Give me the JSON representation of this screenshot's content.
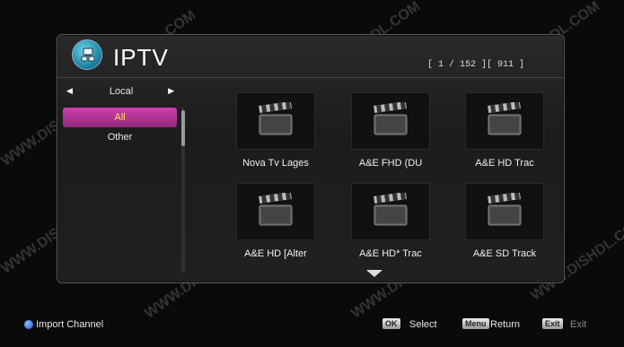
{
  "header": {
    "title": "IPTV",
    "counter": "[ 1 / 152 ][ 911 ]"
  },
  "categories": {
    "group_label": "Local",
    "items": [
      "All",
      "Other"
    ],
    "selected_index": 0
  },
  "channels": [
    {
      "label": "Nova Tv Lages",
      "icon": "clapperboard-icon"
    },
    {
      "label": "A&E FHD (DU",
      "icon": "clapperboard-icon"
    },
    {
      "label": "A&E HD  Trac",
      "icon": "clapperboard-icon"
    },
    {
      "label": "A&E HD [Alter",
      "icon": "clapperboard-icon"
    },
    {
      "label": "A&E HD*  Trac",
      "icon": "clapperboard-icon"
    },
    {
      "label": "A&E SD  Track",
      "icon": "clapperboard-icon"
    }
  ],
  "footer": {
    "import_label": "Import Channel",
    "ok_key": "OK",
    "ok_label": "Select",
    "menu_key": "Menu",
    "menu_label": "Return",
    "exit_key": "Exit",
    "exit_label": "Exit"
  },
  "watermark_text": "WWW.DISHDL.COM",
  "colors": {
    "selected_bg": "#c03ca0",
    "selected_text": "#ffe84a",
    "blue_button": "#1a56d0"
  }
}
